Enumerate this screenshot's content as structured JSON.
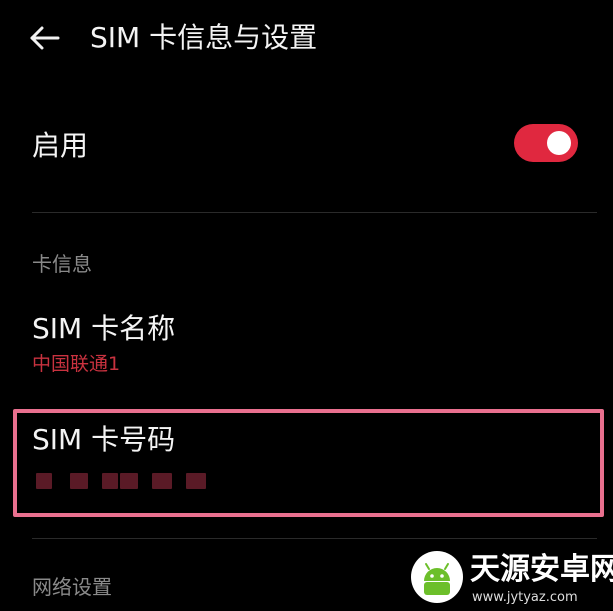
{
  "header": {
    "back_icon": "arrow-left-icon",
    "title": "SIM 卡信息与设置"
  },
  "enable": {
    "label": "启用",
    "toggle_on": true,
    "toggle_color": "#e0283f"
  },
  "card_info": {
    "section_label": "卡信息",
    "sim_name": {
      "title": "SIM 卡名称",
      "value": "中国联通1"
    },
    "sim_number": {
      "title": "SIM 卡号码",
      "value_masked": true
    },
    "highlight_color": "#e9708f"
  },
  "network": {
    "section_label": "网络设置"
  },
  "watermark": {
    "name": "天源安卓网",
    "url": "www.jytyaz.com"
  },
  "colors": {
    "background": "#000000",
    "text_primary": "#f4f4f4",
    "text_secondary": "#8a8a8a",
    "accent_red": "#c8323f"
  }
}
